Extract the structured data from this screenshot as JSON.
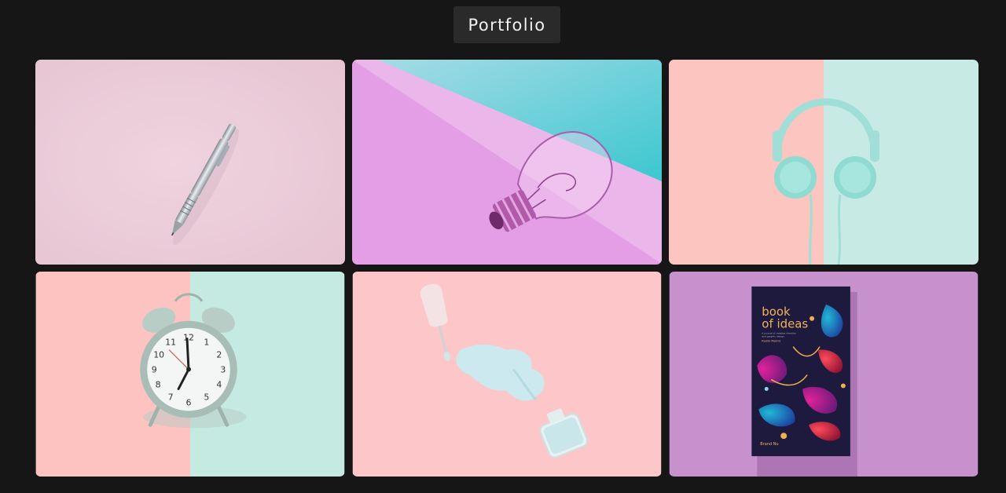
{
  "header": {
    "title": "Portfolio"
  },
  "gallery": {
    "items": [
      {
        "icon": "pen-icon"
      },
      {
        "icon": "lightbulb-icon"
      },
      {
        "icon": "headphones-icon"
      },
      {
        "icon": "alarm-clock-icon"
      },
      {
        "icon": "nail-polish-icon"
      },
      {
        "icon": "book-icon",
        "book": {
          "title_line1": "book",
          "title_line2": "of ideas",
          "subtitle_line1": "A journal of creative direction",
          "subtitle_line2": "and graphic design",
          "author": "Radim Malinic",
          "publisher": "Brand Nu"
        }
      }
    ]
  },
  "colors": {
    "background": "#161616",
    "title_box": "#2a2a2a",
    "pink": "#f9c7c4",
    "mint": "#c5e9e1",
    "lilac": "#c88fcd"
  }
}
